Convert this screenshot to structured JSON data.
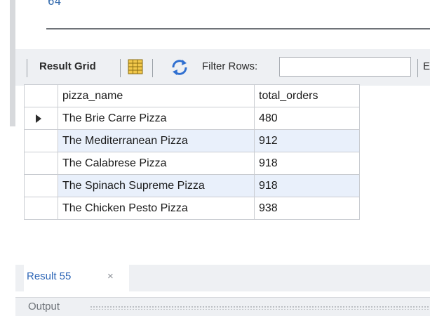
{
  "editor": {
    "fragment": "64"
  },
  "toolbar": {
    "result_grid_label": "Result Grid",
    "grid_icon": "form-grid-icon",
    "refresh_icon": "refresh-icon",
    "filter_label": "Filter Rows:",
    "filter_value": "",
    "cut_label": "E"
  },
  "grid": {
    "columns": [
      "pizza_name",
      "total_orders"
    ],
    "rows": [
      {
        "pizza_name": "The Brie Carre Pizza",
        "total_orders": "480",
        "selected": true
      },
      {
        "pizza_name": "The Mediterranean Pizza",
        "total_orders": "912"
      },
      {
        "pizza_name": "The Calabrese Pizza",
        "total_orders": "918"
      },
      {
        "pizza_name": "The Spinach Supreme Pizza",
        "total_orders": "918"
      },
      {
        "pizza_name": "The Chicken Pesto Pizza",
        "total_orders": "938"
      }
    ]
  },
  "result_tab": {
    "label": "Result 55",
    "close_glyph": "×"
  },
  "output": {
    "label": "Output"
  },
  "colors": {
    "accent": "#2f67b7",
    "row_alt": "#e9f0fb",
    "toolbar_bg": "#eef0f3"
  }
}
